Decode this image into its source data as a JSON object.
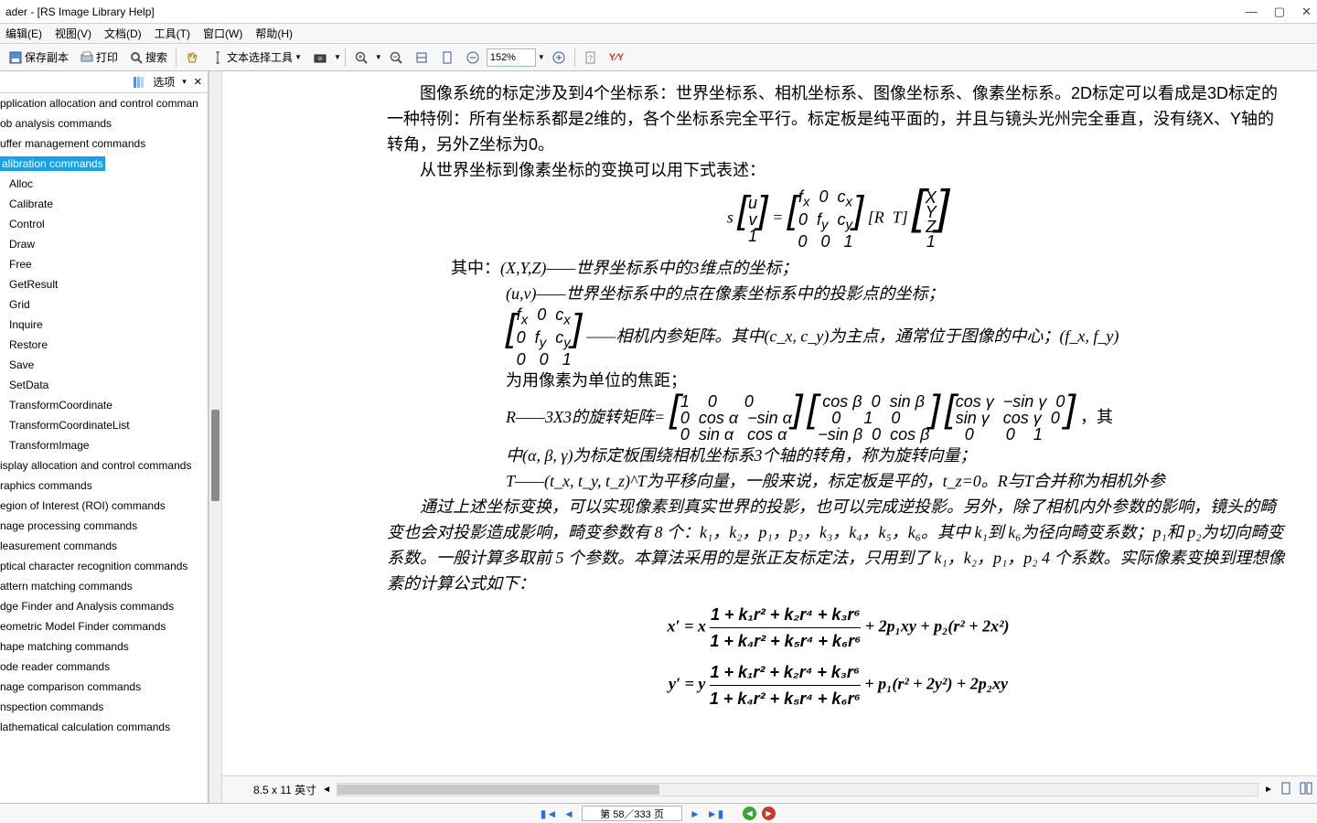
{
  "title": "ader - [RS Image Library Help]",
  "menu": {
    "edit": "编辑(E)",
    "view": "视图(V)",
    "doc": "文档(D)",
    "tool": "工具(T)",
    "window": "窗口(W)",
    "help": "帮助(H)"
  },
  "toolbar": {
    "save_copy": "保存副本",
    "print": "打印",
    "search": "搜索",
    "text_select": "文本选择工具",
    "zoom": "152%"
  },
  "sidebar": {
    "options_label": "选项",
    "items_l1": [
      "pplication allocation and control comman",
      "ob analysis commands",
      "uffer management commands"
    ],
    "selected": "alibration commands",
    "items_l2": [
      "Alloc",
      "Calibrate",
      "Control",
      "Draw",
      "Free",
      "GetResult",
      "Grid",
      "Inquire",
      "Restore",
      "Save",
      "SetData",
      "TransformCoordinate",
      "TransformCoordinateList",
      "TransformImage"
    ],
    "items_l1b": [
      "isplay allocation and control commands",
      "raphics commands",
      "egion of Interest (ROI) commands",
      "nage processing commands",
      "leasurement commands",
      "ptical character recognition commands",
      "attern matching commands",
      "dge Finder and Analysis commands",
      "eometric Model Finder commands",
      "hape matching commands",
      "ode reader commands",
      "nage comparison commands",
      "nspection commands",
      "lathematical calculation commands"
    ]
  },
  "doc": {
    "p1": "图像系统的标定涉及到4个坐标系：世界坐标系、相机坐标系、图像坐标系、像素坐标系。2D标定可以看成是3D标定的一种特例：所有坐标系都是2维的，各个坐标系完全平行。标定板是纯平面的，并且与镜头光州完全垂直，没有绕X、Y轴的转角，另外Z坐标为0。",
    "p2": "从世界坐标到像素坐标的变换可以用下式表述：",
    "where": "其中：",
    "w1": "(X,Y,Z)——世界坐标系中的3维点的坐标；",
    "w2": "(u,v)——世界坐标系中的点在像素坐标系中的投影点的坐标；",
    "w3b": "——相机内参矩阵。其中(c_x, c_y)为主点，通常位于图像的中心；(f_x, f_y)",
    "w3c": "为用像素为单位的焦距；",
    "w4a": "R——3X3的旋转矩阵=",
    "w4b": "，其",
    "w4c": "中(α, β, γ)为标定板围绕相机坐标系3个轴的转角，称为旋转向量；",
    "w5": "T——(t_x, t_y, t_z)^T为平移向量，一般来说，标定板是平的，t_z=0。R与T合并称为相机外参",
    "p3": "通过上述坐标变换，可以实现像素到真实世界的投影，也可以完成逆投影。另外，除了相机内外参数的影响，镜头的畸变也会对投影造成影响，畸变参数有 8 个：k₁，k₂，p₁，p₂，k₃，k₄，k₅，k₆。其中 k₁到 k₆为径向畸变系数；p₁和 p₂为切向畸变系数。一般计算多取前 5 个参数。本算法采用的是张正友标定法，只用到了 k₁，k₂，p₁，p₂ 4 个系数。实际像素变换到理想像素的计算公式如下："
  },
  "footer": {
    "page_size": "8.5 x 11 英寸",
    "page": "第 58／333 页"
  }
}
